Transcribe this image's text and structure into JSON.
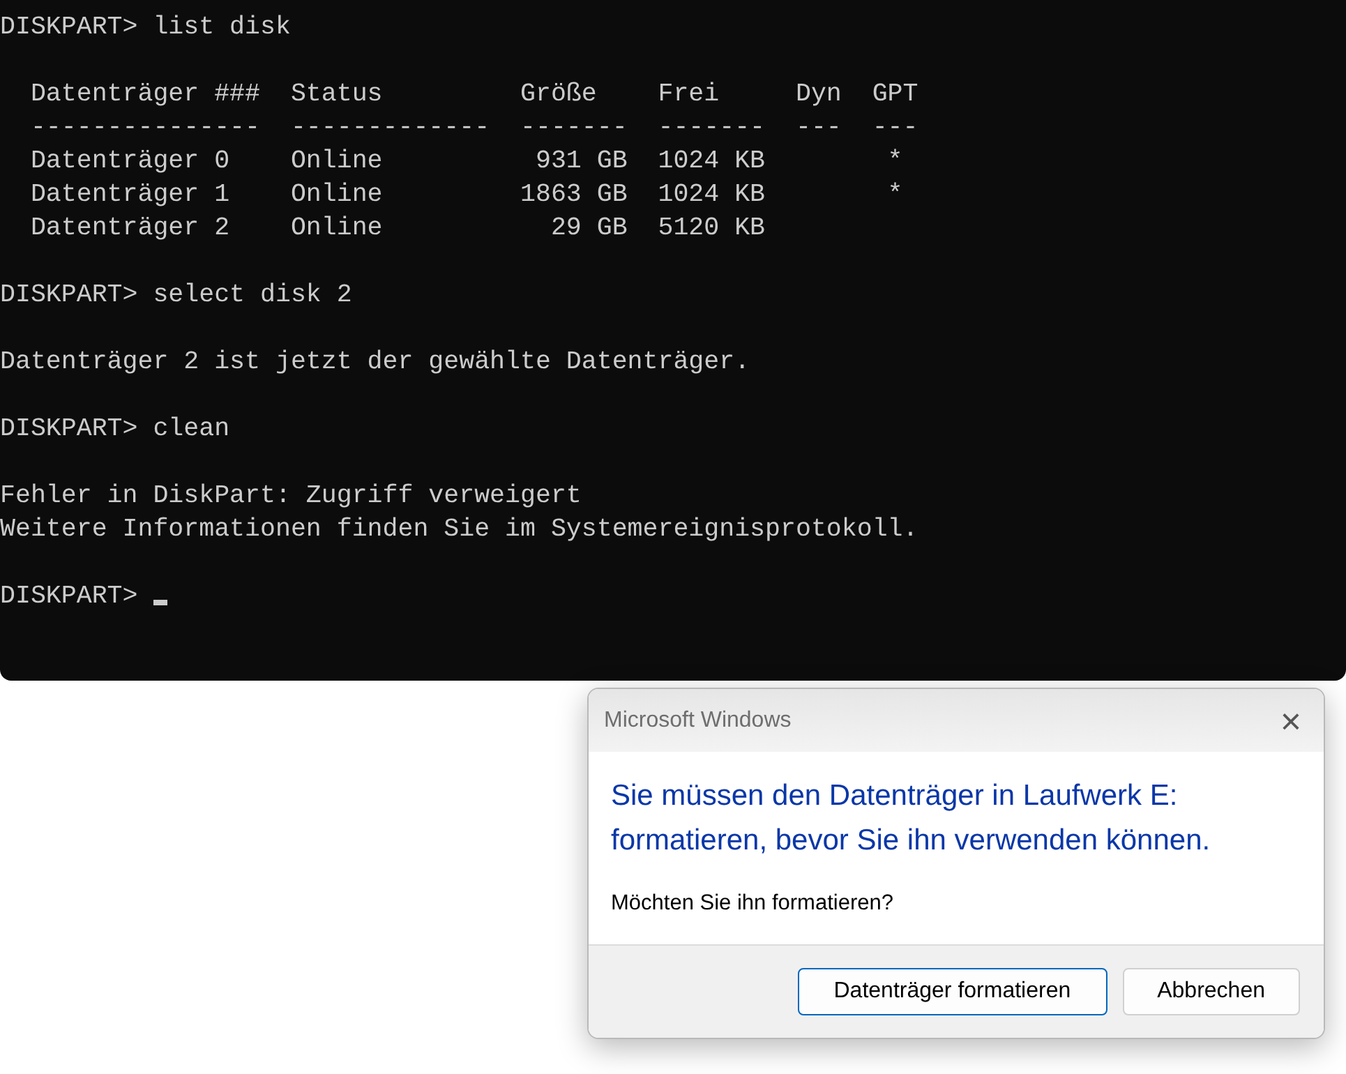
{
  "console": {
    "blocks": [
      {
        "lines": [
          {
            "kind": "prompt",
            "prompt": "DISKPART>",
            "command": "list disk",
            "cursor": false
          }
        ]
      },
      {
        "lines": [
          {
            "kind": "output",
            "text": "  Datenträger ###  Status         Größe    Frei     Dyn  GPT"
          },
          {
            "kind": "output",
            "text": "  ---------------  -------------  -------  -------  ---  ---"
          },
          {
            "kind": "output",
            "text": "  Datenträger 0    Online          931 GB  1024 KB        *"
          },
          {
            "kind": "output",
            "text": "  Datenträger 1    Online         1863 GB  1024 KB        *"
          },
          {
            "kind": "output",
            "text": "  Datenträger 2    Online           29 GB  5120 KB"
          }
        ]
      },
      {
        "lines": [
          {
            "kind": "prompt",
            "prompt": "DISKPART>",
            "command": "select disk 2",
            "cursor": false
          }
        ]
      },
      {
        "lines": [
          {
            "kind": "output",
            "text": "Datenträger 2 ist jetzt der gewählte Datenträger."
          }
        ]
      },
      {
        "lines": [
          {
            "kind": "prompt",
            "prompt": "DISKPART>",
            "command": "clean",
            "cursor": false
          }
        ]
      },
      {
        "lines": [
          {
            "kind": "output",
            "text": "Fehler in DiskPart: Zugriff verweigert"
          },
          {
            "kind": "output",
            "text": "Weitere Informationen finden Sie im Systemereignisprotokoll."
          }
        ]
      },
      {
        "lines": [
          {
            "kind": "prompt",
            "prompt": "DISKPART>",
            "cursor": true
          }
        ]
      }
    ]
  },
  "dialog": {
    "title": "Microsoft Windows",
    "close": "×",
    "instruction": "Sie müssen den Datenträger in Laufwerk E: formatieren, bevor Sie ihn verwenden können.",
    "question": "Möchten Sie ihn formatieren?",
    "buttons": [
      {
        "label": "Datenträger formatieren",
        "default": true
      },
      {
        "label": "Abbrechen",
        "default": false
      }
    ]
  }
}
